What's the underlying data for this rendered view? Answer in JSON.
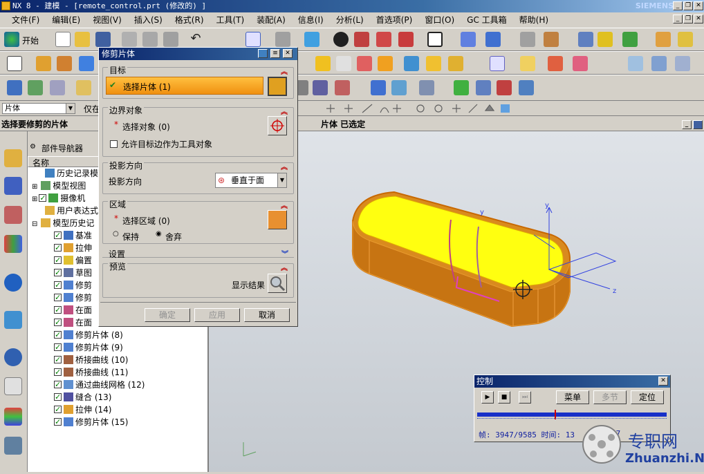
{
  "window": {
    "title": "NX 8 - 建模 - [remote_control.prt (修改的) ]",
    "brand": "SIEMENS"
  },
  "menu": [
    "文件(F)",
    "编辑(E)",
    "视图(V)",
    "插入(S)",
    "格式(R)",
    "工具(T)",
    "装配(A)",
    "信息(I)",
    "分析(L)",
    "首选项(P)",
    "窗口(O)",
    "GC 工具箱",
    "帮助(H)"
  ],
  "toolbar": {
    "start_label": "开始"
  },
  "selection_bar": {
    "filter_value": "片体",
    "scope_value": "仅在"
  },
  "cue_line": {
    "prompt": "选择要修剪的片体",
    "status": "片体 已选定"
  },
  "navigator": {
    "title": "部件导航器",
    "column_name": "名称",
    "items": [
      {
        "label": "历史记录模",
        "indent": 1,
        "check": false,
        "expand": ""
      },
      {
        "label": "模型视图",
        "indent": 0,
        "check": false,
        "expand": "+"
      },
      {
        "label": "摄像机",
        "indent": 0,
        "check": true,
        "expand": "+"
      },
      {
        "label": "用户表达式",
        "indent": 1,
        "check": false,
        "expand": ""
      },
      {
        "label": "模型历史记",
        "indent": 0,
        "check": false,
        "expand": "-"
      },
      {
        "label": "基准",
        "indent": 2,
        "check": true,
        "expand": ""
      },
      {
        "label": "拉伸",
        "indent": 2,
        "check": true,
        "expand": ""
      },
      {
        "label": "偏置",
        "indent": 2,
        "check": true,
        "expand": ""
      },
      {
        "label": "草图",
        "indent": 2,
        "check": true,
        "expand": ""
      },
      {
        "label": "修剪",
        "indent": 2,
        "check": true,
        "expand": ""
      },
      {
        "label": "修剪",
        "indent": 2,
        "check": true,
        "expand": ""
      },
      {
        "label": "在面",
        "indent": 2,
        "check": true,
        "expand": ""
      },
      {
        "label": "在面",
        "indent": 2,
        "check": true,
        "expand": ""
      },
      {
        "label": "修剪片体 (8)",
        "indent": 2,
        "check": true,
        "expand": ""
      },
      {
        "label": "修剪片体 (9)",
        "indent": 2,
        "check": true,
        "expand": ""
      },
      {
        "label": "桥接曲线 (10)",
        "indent": 2,
        "check": true,
        "expand": ""
      },
      {
        "label": "桥接曲线 (11)",
        "indent": 2,
        "check": true,
        "expand": ""
      },
      {
        "label": "通过曲线网格 (12)",
        "indent": 2,
        "check": true,
        "expand": ""
      },
      {
        "label": "缝合 (13)",
        "indent": 2,
        "check": true,
        "expand": ""
      },
      {
        "label": "拉伸 (14)",
        "indent": 2,
        "check": true,
        "expand": ""
      },
      {
        "label": "修剪片体 (15)",
        "indent": 2,
        "check": true,
        "expand": ""
      }
    ]
  },
  "dialog": {
    "title": "修剪片体",
    "target": {
      "header": "目标",
      "select_label": "选择片体 (1)"
    },
    "boundary": {
      "header": "边界对象",
      "select_label": "选择对象 (0)",
      "checkbox_label": "允许目标边作为工具对象"
    },
    "projection": {
      "header": "投影方向",
      "label": "投影方向",
      "value": "垂直于面"
    },
    "region": {
      "header": "区域",
      "select_label": "选择区域 (0)",
      "keep_label": "保持",
      "discard_label": "舍弃"
    },
    "settings": {
      "header": "设置"
    },
    "preview": {
      "header": "预览",
      "show_label": "显示结果"
    },
    "buttons": {
      "ok": "确定",
      "apply": "应用",
      "cancel": "取消"
    }
  },
  "control": {
    "title": "控制",
    "menu_btn": "菜单",
    "multistep_btn": "多节",
    "locate_btn": "定位",
    "frame_label": "帧: 3947/9585 时间: 13",
    "time_suffix": "57",
    "progress": 0.41
  },
  "watermark": {
    "cn": "专职网",
    "url": "Zhuanzhi.Net"
  },
  "colors": {
    "accent_yellow": "#ffff00",
    "body_orange": "#e08a1e",
    "title_blue": "#0a246a"
  }
}
